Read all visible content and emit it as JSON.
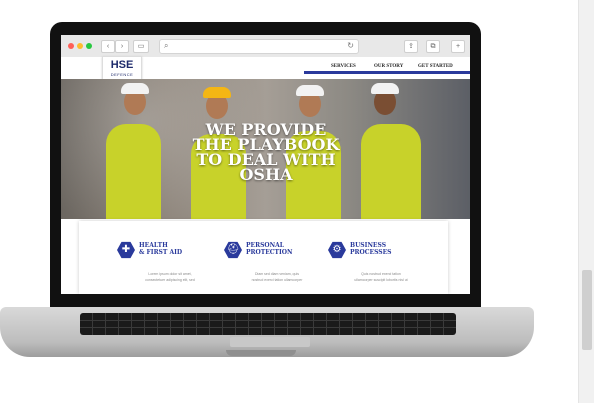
{
  "browser": {
    "back": "‹",
    "forward": "›"
  },
  "site": {
    "logo_main": "HSE",
    "logo_sub": "DEFENCE",
    "nav": [
      "SERVICES",
      "OUR STORY",
      "GET STARTED"
    ]
  },
  "hero": {
    "title": "WE PROVIDE\nTHE PLAYBOOK\nTO DEAL WITH\nOSHA"
  },
  "features": [
    {
      "title": "HEALTH\n& FIRST AID",
      "desc": "Lorem ipsum dolor sit amet,\nconsectetuer adipiscing elit, sed",
      "icon": "plus-icon"
    },
    {
      "title": "PERSONAL\nPROTECTION",
      "desc": "Diam sed diam veniam, quis\nnostrud exerci tation ullamcorper",
      "icon": "hardhat-icon"
    },
    {
      "title": "BUSINESS\nPROCESSES",
      "desc": "Quis nostrud exerci tation\nullamcorper suscipit lobortis nisl ut",
      "icon": "gear-icon"
    }
  ],
  "colors": {
    "brand": "#2a3a9c",
    "vest": "#c8d22a"
  }
}
